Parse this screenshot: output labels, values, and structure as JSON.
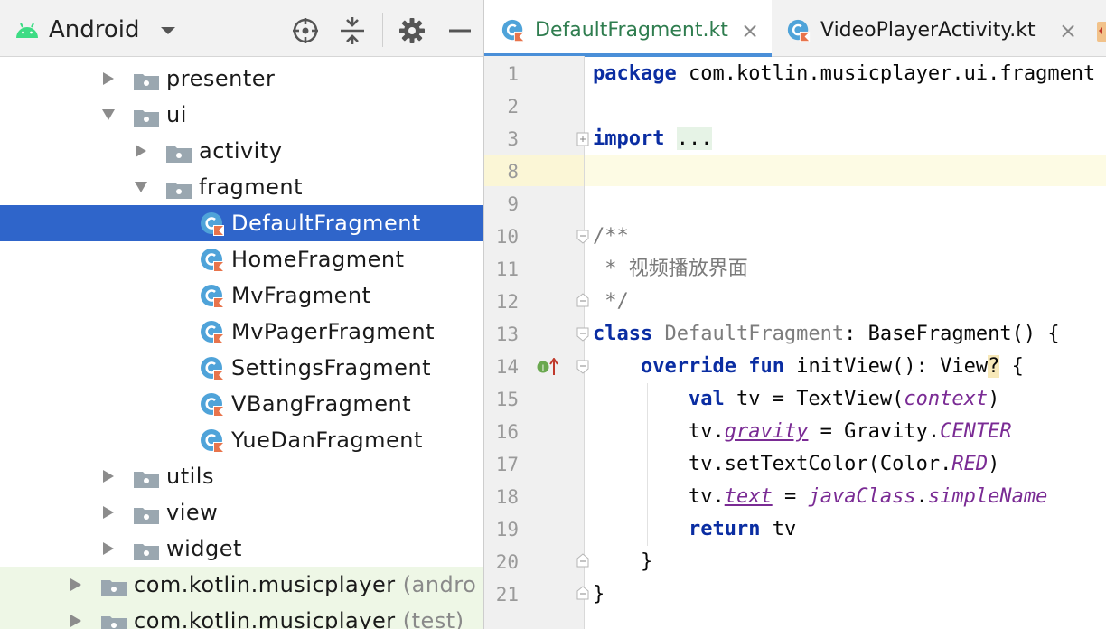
{
  "project_panel": {
    "view_selector": "Android",
    "toolbar_icons": [
      "locate-icon",
      "collapse-all-icon",
      "settings-gear-icon",
      "hide-icon"
    ],
    "tree": [
      {
        "label": "presenter",
        "kind": "folder",
        "expanded": false
      },
      {
        "label": "ui",
        "kind": "folder",
        "expanded": true
      },
      {
        "label": "activity",
        "kind": "folder",
        "expanded": false
      },
      {
        "label": "fragment",
        "kind": "folder",
        "expanded": true
      },
      {
        "label": "DefaultFragment",
        "kind": "kotlin-class",
        "selected": true
      },
      {
        "label": "HomeFragment",
        "kind": "kotlin-class"
      },
      {
        "label": "MvFragment",
        "kind": "kotlin-class"
      },
      {
        "label": "MvPagerFragment",
        "kind": "kotlin-class"
      },
      {
        "label": "SettingsFragment",
        "kind": "kotlin-class"
      },
      {
        "label": "VBangFragment",
        "kind": "kotlin-class"
      },
      {
        "label": "YueDanFragment",
        "kind": "kotlin-class"
      },
      {
        "label": "utils",
        "kind": "folder",
        "expanded": false
      },
      {
        "label": "view",
        "kind": "folder",
        "expanded": false
      },
      {
        "label": "widget",
        "kind": "folder",
        "expanded": false
      },
      {
        "label": "com.kotlin.musicplayer",
        "suffix": "(andro",
        "kind": "package",
        "expanded": false
      },
      {
        "label": "com.kotlin.musicplayer",
        "suffix": "(test)",
        "kind": "package",
        "expanded": false
      }
    ]
  },
  "editor": {
    "tabs": [
      {
        "label": "DefaultFragment.kt",
        "active": true,
        "close": "×"
      },
      {
        "label": "VideoPlayerActivity.kt",
        "active": false,
        "close": "×"
      }
    ],
    "line_numbers": [
      "1",
      "2",
      "3",
      "8",
      "9",
      "10",
      "11",
      "12",
      "13",
      "14",
      "15",
      "16",
      "17",
      "18",
      "19",
      "20",
      "21"
    ],
    "code": {
      "l1_kw": "package",
      "l1_rest": " com.kotlin.musicplayer.ui.fragment",
      "l3_kw": "import",
      "l3_fold": "...",
      "l10": "/**",
      "l11_prefix": " * ",
      "l11_text": "视频播放界面",
      "l12": " */",
      "l13_kw": "class",
      "l13_name": " DefaultFragment",
      "l13_rest": ": BaseFragment() {",
      "l14_kw1": "override",
      "l14_kw2": "fun",
      "l14_a": " initView(): View",
      "l14_q": "?",
      "l14_b": " {",
      "l15_kw": "val",
      "l15_a": " tv = TextView(",
      "l15_ctx": "context",
      "l15_b": ")",
      "l16_a": "tv.",
      "l16_prop": "gravity",
      "l16_b": " = Gravity.",
      "l16_const": "CENTER",
      "l17_a": "tv.setTextColor(Color.",
      "l17_const": "RED",
      "l17_b": ")",
      "l18_a": "tv.",
      "l18_prop": "text",
      "l18_b": " = ",
      "l18_jc": "javaClass",
      "l18_dot": ".",
      "l18_sn": "simpleName",
      "l19_kw": "return",
      "l19_rest": " tv",
      "l20": "}",
      "l21": "}"
    }
  },
  "colors": {
    "selection": "#2f65ca",
    "keyword": "#0a2da2",
    "purple": "#7a2b94",
    "module_bg": "#eef7e6",
    "current_line": "#fdfbe4"
  }
}
